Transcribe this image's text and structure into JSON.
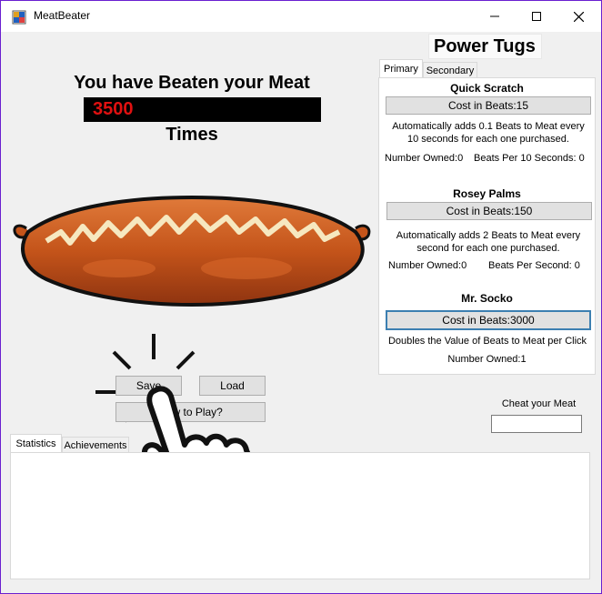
{
  "window": {
    "title": "MeatBeater",
    "minimize_glyph": "—",
    "close_glyph": "✕"
  },
  "main": {
    "headline": "You have Beaten your Meat",
    "count": "3500",
    "times": "Times"
  },
  "buttons": {
    "save": "Save",
    "load": "Load",
    "how_to_play": "How to Play?"
  },
  "power_tugs": {
    "title": "Power Tugs",
    "tabs": [
      "Primary",
      "Secondary"
    ],
    "items": [
      {
        "name": "Quick Scratch",
        "cost": "Cost in Beats:15",
        "description": "Automatically adds 0.1 Beats to Meat every 10 seconds for each one purchased.",
        "owned": "Number Owned:0",
        "rate": "Beats Per 10 Seconds: 0"
      },
      {
        "name": "Rosey Palms",
        "cost": "Cost in Beats:150",
        "description": "Automatically adds 2 Beats to Meat every second for each one purchased.",
        "owned": "Number Owned:0",
        "rate": "Beats Per Second: 0"
      },
      {
        "name": "Mr. Socko",
        "cost": "Cost in Beats:3000",
        "description": "Doubles the Value of Beats to Meat per Click",
        "owned": "Number Owned:1"
      }
    ]
  },
  "cheat": {
    "label": "Cheat your Meat",
    "value": ""
  },
  "bottom_tabs": [
    "Statistics",
    "Achievements"
  ],
  "colors": {
    "border": "#6a1fd0",
    "counter_text": "#e01010",
    "sausage": "#c4541a"
  },
  "icons": {
    "sausage": "sausage-image",
    "hand": "pointing-hand-icon"
  }
}
